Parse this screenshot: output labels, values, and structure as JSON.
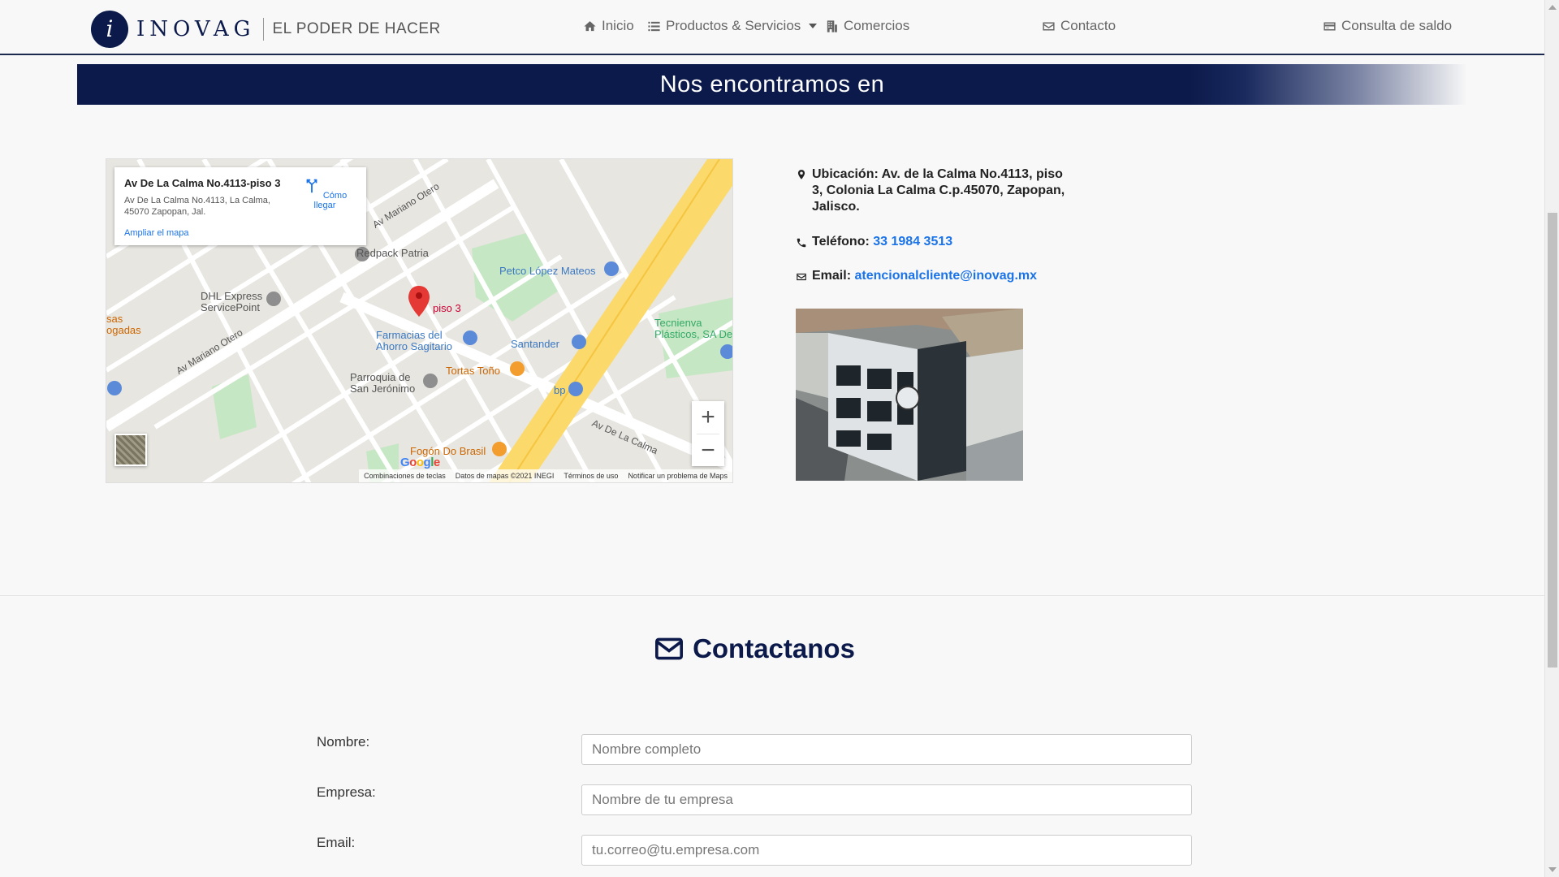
{
  "navbar": {
    "brand_name": "INOVAG",
    "brand_tagline": "EL PODER DE HACER",
    "links": {
      "inicio": "Inicio",
      "productos": "Productos & Servicios",
      "comercios": "Comercios",
      "contacto": "Contacto",
      "saldo": "Consulta de saldo"
    }
  },
  "banner": {
    "title": "Nos encontramos en"
  },
  "map": {
    "card_title": "Av De La Calma No.4113-piso 3",
    "card_address": "Av De La Calma No.4113, La Calma, 45070 Zapopan, Jal.",
    "directions_label": "Cómo llegar",
    "enlarge_label": "Ampliar el mapa",
    "pin_label": "piso 3",
    "labels": {
      "redpack": "Redpack Patria",
      "dhl": "DHL Express ServicePoint",
      "petco": "Petco López Mateos",
      "farmacias": "Farmacias del Ahorro Sagitario",
      "santander": "Santander",
      "tortas": "Tortas Toño",
      "parroquia": "Parroquia de San Jerónimo",
      "fogon": "Fogón Do Brasil",
      "bp": "bp",
      "tecnienva": "Tecnienva Plásticos, SA De",
      "sas": "sas ogadas",
      "av_mariano_1": "Av Mariano Otero",
      "av_mariano_2": "Av Mariano Otero",
      "av_la_calma": "Av De La Calma"
    },
    "zoom_in": "+",
    "zoom_out": "−",
    "google": "Google",
    "footer": {
      "shortcuts": "Combinaciones de teclas",
      "data": "Datos de mapas ©2021 INEGI",
      "terms": "Términos de uso",
      "report": "Notificar un problema de Maps"
    }
  },
  "info": {
    "location_label": "Ubicación:",
    "location_text": "Av. de la Calma No.4113, piso 3, Colonia La Calma C.p.45070, Zapopan, Jalisco.",
    "phone_label": "Teléfono:",
    "phone_value": "33 1984 3513",
    "email_label": "Email:",
    "email_value": "atencionalcliente@inovag.mx"
  },
  "contact": {
    "title": "Contactanos",
    "fields": {
      "name": {
        "label": "Nombre:",
        "placeholder": "Nombre completo"
      },
      "company": {
        "label": "Empresa:",
        "placeholder": "Nombre de tu empresa"
      },
      "email": {
        "label": "Email:",
        "placeholder": "tu.correo@tu.empresa.com"
      }
    }
  },
  "colors": {
    "navy": "#0b1a4a",
    "link": "#1a73e8"
  }
}
